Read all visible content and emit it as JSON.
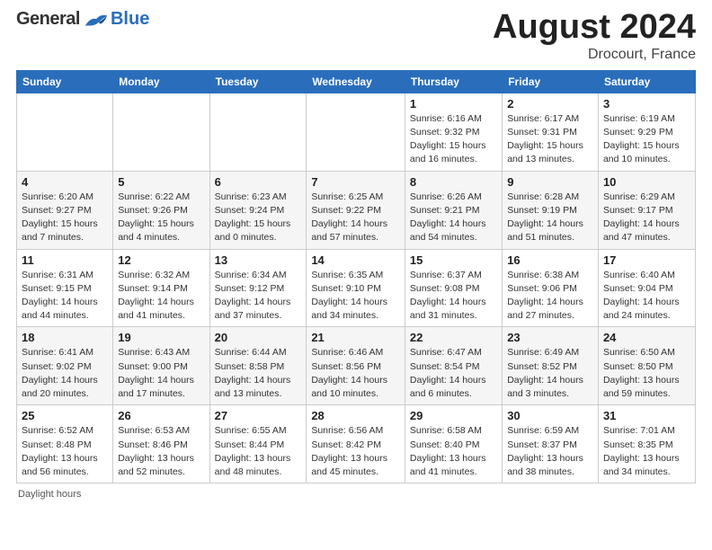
{
  "header": {
    "logo_general": "General",
    "logo_blue": "Blue",
    "title": "August 2024",
    "location": "Drocourt, France"
  },
  "days_of_week": [
    "Sunday",
    "Monday",
    "Tuesday",
    "Wednesday",
    "Thursday",
    "Friday",
    "Saturday"
  ],
  "footer": "Daylight hours",
  "weeks": [
    [
      {
        "day": "",
        "detail": ""
      },
      {
        "day": "",
        "detail": ""
      },
      {
        "day": "",
        "detail": ""
      },
      {
        "day": "",
        "detail": ""
      },
      {
        "day": "1",
        "detail": "Sunrise: 6:16 AM\nSunset: 9:32 PM\nDaylight: 15 hours\nand 16 minutes."
      },
      {
        "day": "2",
        "detail": "Sunrise: 6:17 AM\nSunset: 9:31 PM\nDaylight: 15 hours\nand 13 minutes."
      },
      {
        "day": "3",
        "detail": "Sunrise: 6:19 AM\nSunset: 9:29 PM\nDaylight: 15 hours\nand 10 minutes."
      }
    ],
    [
      {
        "day": "4",
        "detail": "Sunrise: 6:20 AM\nSunset: 9:27 PM\nDaylight: 15 hours\nand 7 minutes."
      },
      {
        "day": "5",
        "detail": "Sunrise: 6:22 AM\nSunset: 9:26 PM\nDaylight: 15 hours\nand 4 minutes."
      },
      {
        "day": "6",
        "detail": "Sunrise: 6:23 AM\nSunset: 9:24 PM\nDaylight: 15 hours\nand 0 minutes."
      },
      {
        "day": "7",
        "detail": "Sunrise: 6:25 AM\nSunset: 9:22 PM\nDaylight: 14 hours\nand 57 minutes."
      },
      {
        "day": "8",
        "detail": "Sunrise: 6:26 AM\nSunset: 9:21 PM\nDaylight: 14 hours\nand 54 minutes."
      },
      {
        "day": "9",
        "detail": "Sunrise: 6:28 AM\nSunset: 9:19 PM\nDaylight: 14 hours\nand 51 minutes."
      },
      {
        "day": "10",
        "detail": "Sunrise: 6:29 AM\nSunset: 9:17 PM\nDaylight: 14 hours\nand 47 minutes."
      }
    ],
    [
      {
        "day": "11",
        "detail": "Sunrise: 6:31 AM\nSunset: 9:15 PM\nDaylight: 14 hours\nand 44 minutes."
      },
      {
        "day": "12",
        "detail": "Sunrise: 6:32 AM\nSunset: 9:14 PM\nDaylight: 14 hours\nand 41 minutes."
      },
      {
        "day": "13",
        "detail": "Sunrise: 6:34 AM\nSunset: 9:12 PM\nDaylight: 14 hours\nand 37 minutes."
      },
      {
        "day": "14",
        "detail": "Sunrise: 6:35 AM\nSunset: 9:10 PM\nDaylight: 14 hours\nand 34 minutes."
      },
      {
        "day": "15",
        "detail": "Sunrise: 6:37 AM\nSunset: 9:08 PM\nDaylight: 14 hours\nand 31 minutes."
      },
      {
        "day": "16",
        "detail": "Sunrise: 6:38 AM\nSunset: 9:06 PM\nDaylight: 14 hours\nand 27 minutes."
      },
      {
        "day": "17",
        "detail": "Sunrise: 6:40 AM\nSunset: 9:04 PM\nDaylight: 14 hours\nand 24 minutes."
      }
    ],
    [
      {
        "day": "18",
        "detail": "Sunrise: 6:41 AM\nSunset: 9:02 PM\nDaylight: 14 hours\nand 20 minutes."
      },
      {
        "day": "19",
        "detail": "Sunrise: 6:43 AM\nSunset: 9:00 PM\nDaylight: 14 hours\nand 17 minutes."
      },
      {
        "day": "20",
        "detail": "Sunrise: 6:44 AM\nSunset: 8:58 PM\nDaylight: 14 hours\nand 13 minutes."
      },
      {
        "day": "21",
        "detail": "Sunrise: 6:46 AM\nSunset: 8:56 PM\nDaylight: 14 hours\nand 10 minutes."
      },
      {
        "day": "22",
        "detail": "Sunrise: 6:47 AM\nSunset: 8:54 PM\nDaylight: 14 hours\nand 6 minutes."
      },
      {
        "day": "23",
        "detail": "Sunrise: 6:49 AM\nSunset: 8:52 PM\nDaylight: 14 hours\nand 3 minutes."
      },
      {
        "day": "24",
        "detail": "Sunrise: 6:50 AM\nSunset: 8:50 PM\nDaylight: 13 hours\nand 59 minutes."
      }
    ],
    [
      {
        "day": "25",
        "detail": "Sunrise: 6:52 AM\nSunset: 8:48 PM\nDaylight: 13 hours\nand 56 minutes."
      },
      {
        "day": "26",
        "detail": "Sunrise: 6:53 AM\nSunset: 8:46 PM\nDaylight: 13 hours\nand 52 minutes."
      },
      {
        "day": "27",
        "detail": "Sunrise: 6:55 AM\nSunset: 8:44 PM\nDaylight: 13 hours\nand 48 minutes."
      },
      {
        "day": "28",
        "detail": "Sunrise: 6:56 AM\nSunset: 8:42 PM\nDaylight: 13 hours\nand 45 minutes."
      },
      {
        "day": "29",
        "detail": "Sunrise: 6:58 AM\nSunset: 8:40 PM\nDaylight: 13 hours\nand 41 minutes."
      },
      {
        "day": "30",
        "detail": "Sunrise: 6:59 AM\nSunset: 8:37 PM\nDaylight: 13 hours\nand 38 minutes."
      },
      {
        "day": "31",
        "detail": "Sunrise: 7:01 AM\nSunset: 8:35 PM\nDaylight: 13 hours\nand 34 minutes."
      }
    ]
  ]
}
